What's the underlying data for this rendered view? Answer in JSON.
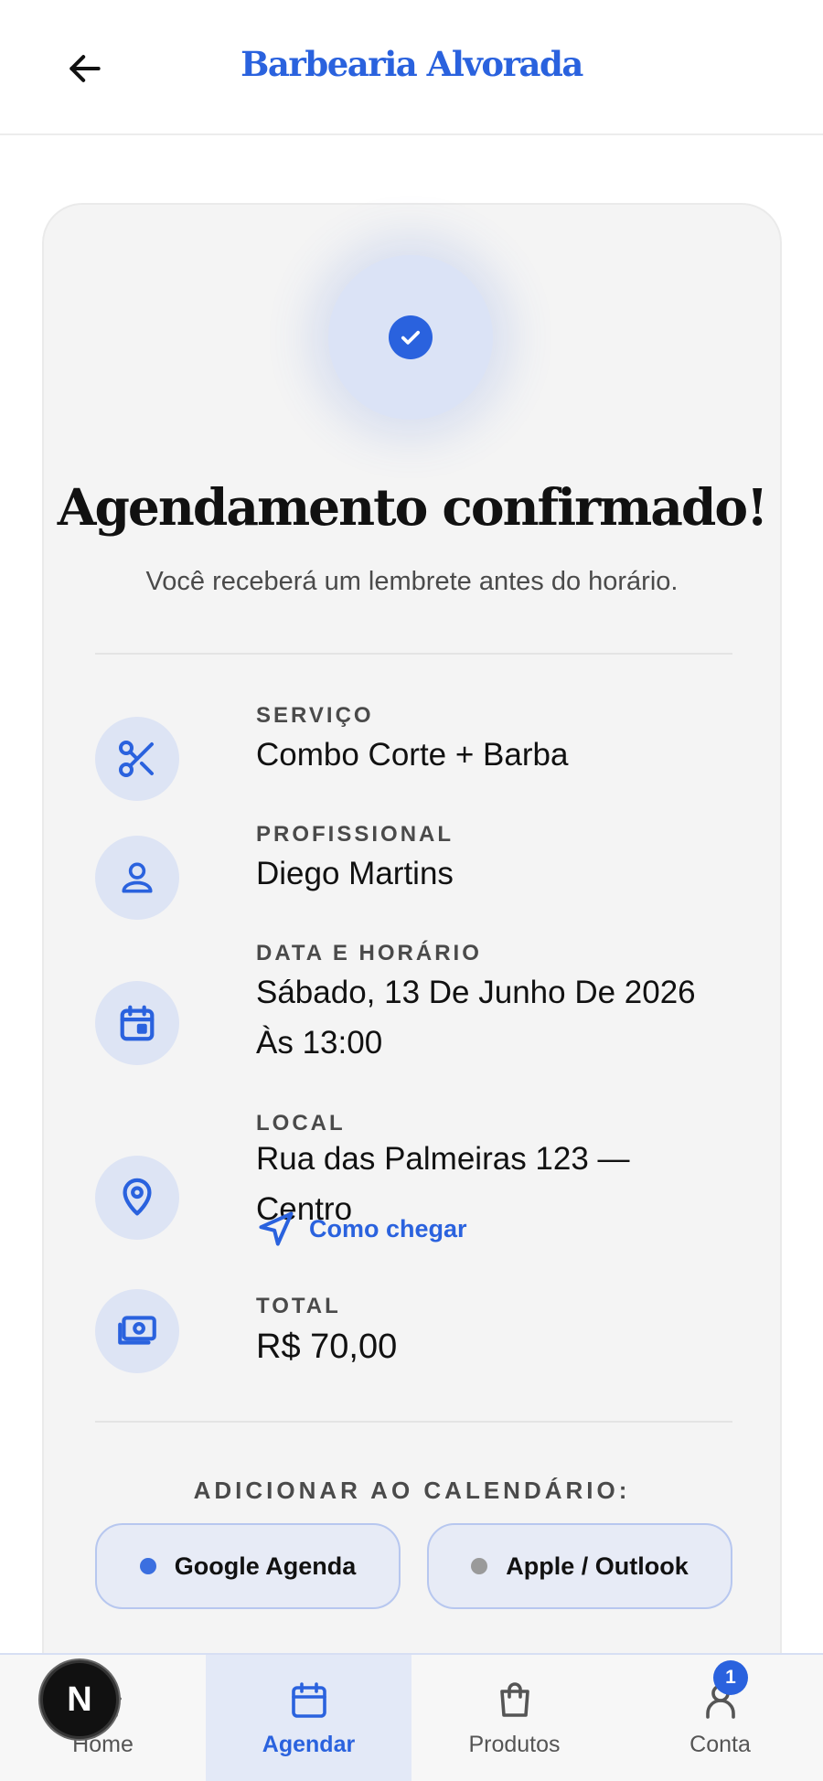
{
  "header": {
    "title": "Barbearia Alvorada"
  },
  "confirmation": {
    "title": "Agendamento confirmado!",
    "subtitle": "Você receberá um lembrete antes do horário."
  },
  "details": {
    "service": {
      "label": "SERVIÇO",
      "value": "Combo Corte + Barba"
    },
    "professional": {
      "label": "PROFISSIONAL",
      "value": "Diego Martins"
    },
    "datetime": {
      "label": "DATA E HORÁRIO",
      "value": "Sábado, 13 De Junho De 2026 Às 13:00"
    },
    "location": {
      "label": "LOCAL",
      "value": "Rua das Palmeiras 123 — Centro",
      "directions_label": "Como chegar"
    },
    "total": {
      "label": "TOTAL",
      "value": "R$ 70,00"
    }
  },
  "calendar": {
    "heading": "ADICIONAR AO CALENDÁRIO:",
    "google_label": "Google Agenda",
    "apple_label": "Apple / Outlook",
    "google_dot_color": "#3b6fe0",
    "apple_dot_color": "#9a9a9a"
  },
  "nav": {
    "items": [
      {
        "label": "Home",
        "icon": "home-icon"
      },
      {
        "label": "Agendar",
        "icon": "calendar-icon"
      },
      {
        "label": "Produtos",
        "icon": "shopping-bag-icon"
      },
      {
        "label": "Conta",
        "icon": "user-icon"
      }
    ],
    "account_badge": "1",
    "active": "Agendar"
  },
  "dev_fab": {
    "letter": "N"
  },
  "colors": {
    "accent": "#2a62de",
    "card_bg": "#f4f4f4",
    "icon_bg": "#dde4f4"
  }
}
